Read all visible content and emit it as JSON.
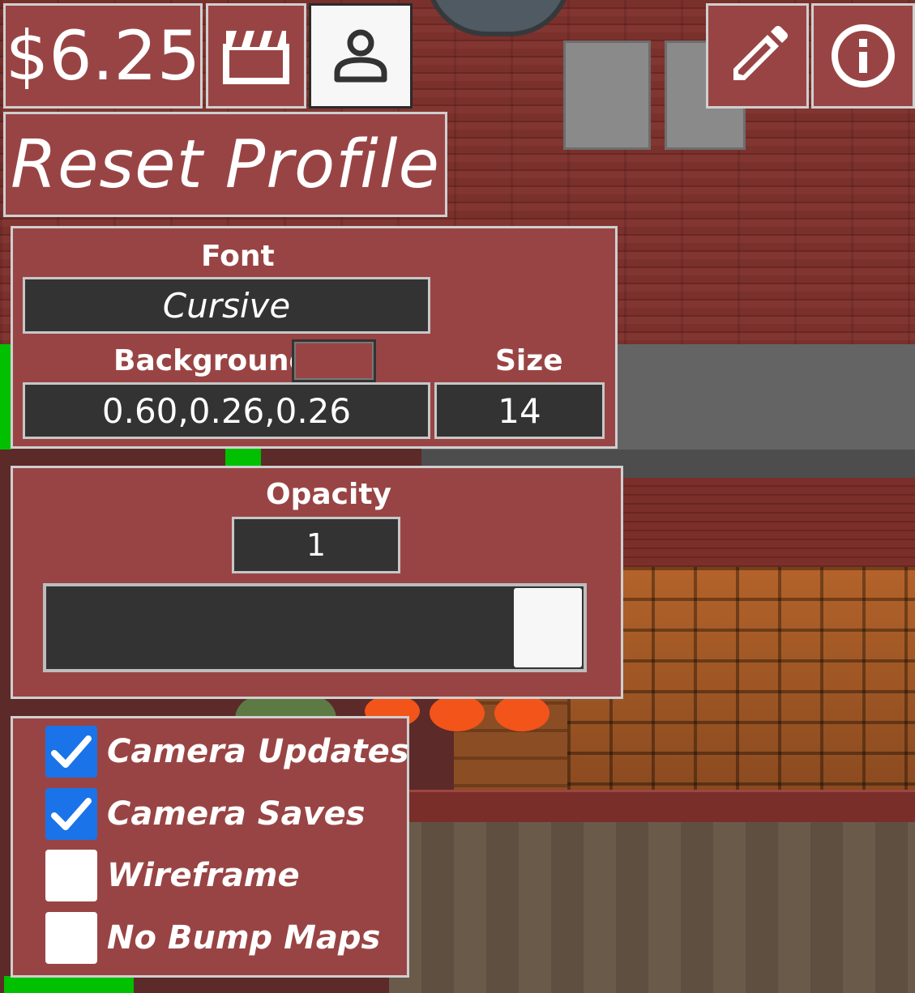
{
  "hud": {
    "money": "$6.25",
    "reset_label": "Reset Profile",
    "icons": {
      "clapperboard": "clapperboard-icon",
      "profile": "user-icon",
      "edit": "pencil-icon",
      "info": "info-icon"
    }
  },
  "font_panel": {
    "font_label": "Font",
    "font_value": "Cursive",
    "background_label": "Background",
    "background_value": "0.60,0.26,0.26",
    "background_swatch": "#994444",
    "size_label": "Size",
    "size_value": "14"
  },
  "opacity_panel": {
    "label": "Opacity",
    "value": "1",
    "slider_level": 1.0
  },
  "toggles": [
    {
      "label": "Camera Updates",
      "checked": true
    },
    {
      "label": "Camera Saves",
      "checked": true
    },
    {
      "label": "Wireframe",
      "checked": false
    },
    {
      "label": "No Bump Maps",
      "checked": false
    }
  ],
  "colors": {
    "panel": "#994444",
    "field": "#333333",
    "checkbox_on": "#1a73e8"
  }
}
